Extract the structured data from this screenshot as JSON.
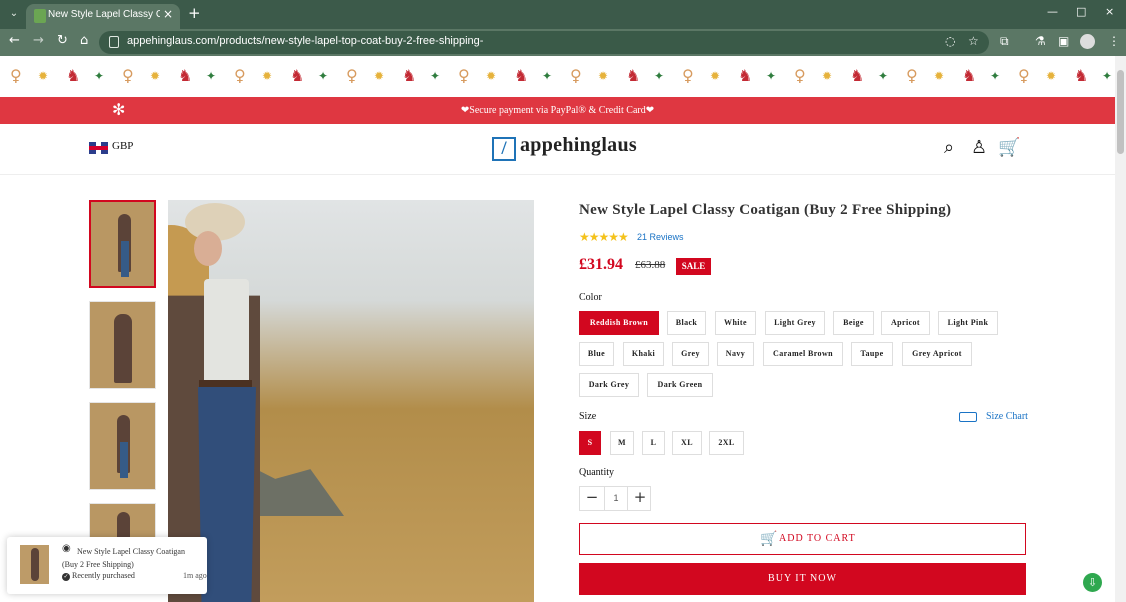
{
  "browser": {
    "tab_title": "New Style Lapel Classy Coatigan",
    "url": "appehinglaus.com/products/new-style-lapel-top-coat-buy-2-free-shipping-",
    "icons": {
      "back": "back-arrow-icon",
      "forward": "forward-arrow-icon",
      "reload": "reload-icon",
      "home": "home-icon",
      "site": "site-info-icon",
      "privacy": "eye-off-icon",
      "bookmark": "bookmark-star-icon",
      "extensions": "puzzle-icon",
      "lab": "flask-icon",
      "side_panel": "side-panel-icon",
      "profile": "profile-icon",
      "menu": "kebab-menu-icon"
    }
  },
  "promo": {
    "text": "❤Secure payment via PayPal® & Credit Card❤"
  },
  "header": {
    "currency": "GBP",
    "logo": "appehinglaus",
    "flag_icon": "uk-flag-icon",
    "icons": [
      "search-icon",
      "account-icon",
      "cart-icon"
    ]
  },
  "product": {
    "title": "New Style Lapel Classy Coatigan (Buy 2 Free Shipping)",
    "rating_stars": "★★★★★",
    "rating_value": 5,
    "reviews": "21 Reviews",
    "price": "£31.94",
    "old_price": "£63.88",
    "sale_badge": "SALE",
    "color_label": "Color",
    "colors": [
      "Reddish Brown",
      "Black",
      "White",
      "Light Grey",
      "Beige",
      "Apricot",
      "Light Pink",
      "Blue",
      "Khaki",
      "Grey",
      "Navy",
      "Caramel Brown",
      "Taupe",
      "Grey Apricot",
      "Dark Grey",
      "Dark Green"
    ],
    "selected_color": "Reddish Brown",
    "size_label": "Size",
    "sizes": [
      "S",
      "M",
      "L",
      "XL",
      "2XL"
    ],
    "selected_size": "S",
    "size_chart": "Size Chart",
    "quantity_label": "Quantity",
    "quantity": "1",
    "add_to_cart": "ADD TO CART",
    "buy_now": "BUY IT NOW"
  },
  "popup": {
    "title": "New Style Lapel Classy Coatigan (Buy 2 Free Shipping)",
    "status": "Recently purchased",
    "time": "1m ago"
  },
  "colors": {
    "browser_dark": "#3c5a4a",
    "browser_mid": "#5b7765",
    "promo_red": "#df3741",
    "accent_red": "#d2071f",
    "link_blue": "#1a73c5",
    "star_gold": "#f4c21b"
  }
}
